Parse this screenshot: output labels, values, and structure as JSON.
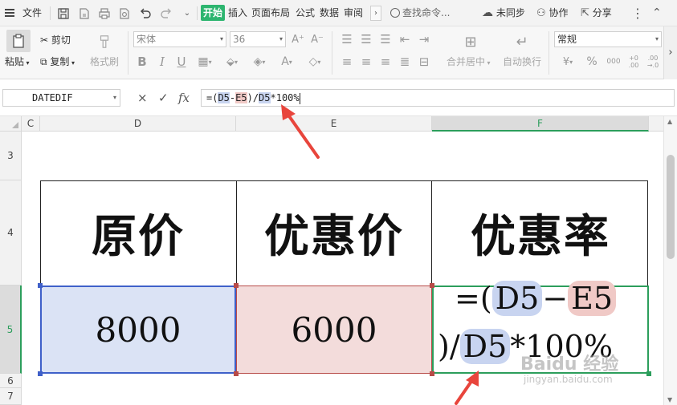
{
  "menubar": {
    "file_label": "文件",
    "tabs": [
      "开始",
      "插入",
      "页面布局",
      "公式",
      "数据",
      "审阅"
    ],
    "more_glyph": "›",
    "search_placeholder": "查找命令...",
    "sync_label": "未同步",
    "collab_label": "协作",
    "share_label": "分享"
  },
  "ribbon": {
    "paste_label": "粘贴",
    "cut_label": "剪切",
    "copy_label": "复制",
    "format_painter_label": "格式刷",
    "font_name": "宋体",
    "font_size": "36",
    "merge_center_label": "合并居中",
    "wrap_text_label": "自动换行",
    "number_format": "常规",
    "currency_glyph": "¥",
    "percent_glyph": "%",
    "thousands_glyph": "000",
    "dec_increase_glyph": "+0 .00",
    "dec_decrease_glyph": ".00 →.0"
  },
  "formula_bar": {
    "name_box": "DATEDIF",
    "cancel_glyph": "×",
    "accept_glyph": "✓",
    "fx_label": "fx",
    "formula_parts": [
      "=(",
      "D5",
      "-",
      "E5",
      ")/",
      "D5",
      "*100%"
    ]
  },
  "columns": [
    "C",
    "D",
    "E",
    "F"
  ],
  "rows": [
    "3",
    "4",
    "5",
    "6",
    "7"
  ],
  "table": {
    "headers": [
      "原价",
      "优惠价",
      "优惠率"
    ],
    "values": [
      "8000",
      "6000"
    ],
    "f5_line1": [
      "=(",
      "D5",
      "−",
      "E5"
    ],
    "f5_line2": [
      ")/",
      "D5",
      "*100%"
    ]
  },
  "watermark": {
    "line1": "Baidu 经验",
    "line2": "jingyan.baidu.com"
  },
  "colors": {
    "accent_green": "#2c9e5c",
    "ref_blue": "#c8d4f0",
    "ref_red": "#f0c9c6",
    "annotation_red": "#e8453c"
  }
}
